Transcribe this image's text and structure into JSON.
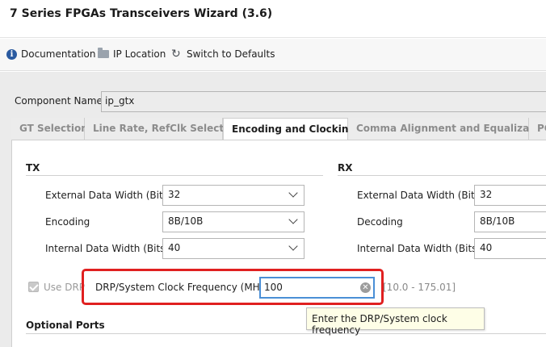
{
  "window": {
    "title": "7 Series FPGAs Transceivers Wizard (3.6)"
  },
  "toolbar": {
    "documentation": "Documentation",
    "ip_location": "IP Location",
    "switch_defaults": "Switch to Defaults",
    "icons": [
      "info-icon",
      "folder-icon",
      "refresh-icon"
    ]
  },
  "component": {
    "label": "Component Name",
    "value": "ip_gtx"
  },
  "tabs": [
    {
      "label": "GT Selection",
      "active": false
    },
    {
      "label": "Line Rate, RefClk Selection",
      "active": false
    },
    {
      "label": "Encoding and Clocking",
      "active": true
    },
    {
      "label": "Comma Alignment and Equalization",
      "active": false
    },
    {
      "label": "PC",
      "active": false
    }
  ],
  "tx": {
    "heading": "TX",
    "rows": [
      {
        "label": "External Data Width (Bits)",
        "value": "32"
      },
      {
        "label": "Encoding",
        "value": "8B/10B"
      },
      {
        "label": "Internal Data Width (Bits)",
        "value": "40"
      }
    ]
  },
  "rx": {
    "heading": "RX",
    "rows": [
      {
        "label": "External Data Width (Bits)",
        "value": "32"
      },
      {
        "label": "Decoding",
        "value": "8B/10B"
      },
      {
        "label": "Internal Data Width (Bits)",
        "value": "40"
      }
    ]
  },
  "drp": {
    "use_drp_label": "Use DRP",
    "use_drp_checked": true,
    "freq_label": "DRP/System Clock Frequency (MHz)",
    "freq_value": "100",
    "range": "[10.0 - 175.01]",
    "tooltip": "Enter the DRP/System clock frequency"
  },
  "optional_ports": {
    "heading": "Optional Ports"
  },
  "colors": {
    "highlight": "#e02020",
    "focus": "#4a8fd6",
    "tooltip_bg": "#fefee7"
  }
}
